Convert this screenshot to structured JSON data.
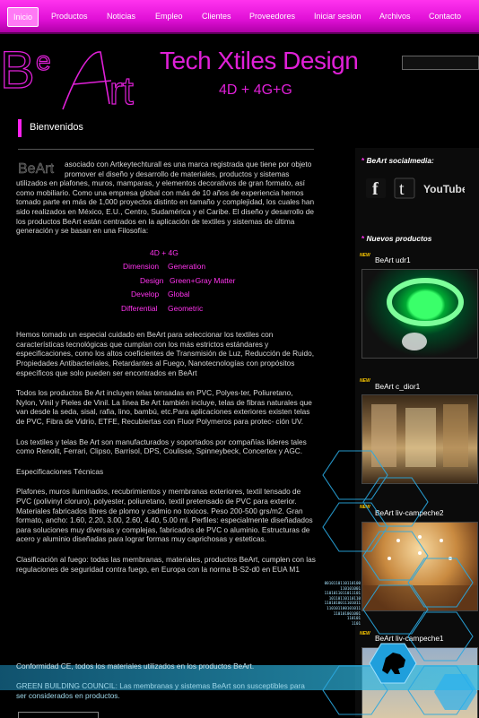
{
  "nav": {
    "items": [
      "Inicio",
      "Productos",
      "Noticias",
      "Empleo",
      "Clientes",
      "Proveedores",
      "Iniciar sesion",
      "Archivos",
      "Contacto"
    ]
  },
  "header": {
    "logo_text": "BeArt",
    "tagline": "Tech Xtiles Design",
    "subtagline": "4D + 4G+G"
  },
  "section": {
    "title": "Bienvenidos"
  },
  "intro": {
    "logo_text": "BeArt",
    "text": "asociado con Artkeytechturall es una marca registrada que tiene por objeto promover el diseño y desarrollo de materiales, productos y sistemas utilizados en plafones, muros, mamparas, y elementos decorativos de gran formato, así como mobiliario. Como una empresa global con más de 10 años de experiencia hemos tomado parte en más de 1,000 proyectos distinto en tamaño y complejidad, los cuales han sido realizados en México, E.U., Centro, Sudamérica y el Caribe. El diseño y desarrollo de los productos BeArt están centrados en la aplicación de textiles y sistemas de última generación y se basan en una Filosofía:"
  },
  "formula": {
    "line1": "4D + 4G",
    "rows": [
      [
        "Dimension",
        "Generation"
      ],
      [
        "Design",
        "Green+Gray Matter"
      ],
      [
        "Develop",
        "Global"
      ],
      [
        "Differential",
        "Geometric"
      ]
    ]
  },
  "paragraphs": [
    "Hemos tomado un especial cuidado en BeArt para seleccionar los textiles con características tecnológicas que cumplan con los más estrictos estándares y especificaciones, como los altos coeficientes de Transmisión de Luz, Reducción de Ruido, Propiedades Antibacteriales, Retardantes al Fuego, Nanotecnologías con propósitos específicos que solo pueden ser encontrados en BeArt",
    "Todos los productos Be Art incluyen telas tensadas en PVC, Polyes-ter, Poliuretano, Nylon, Vinil y Pieles de Vinil. La línea Be Art también incluye, telas de fibras naturales que van desde la seda, sisal, rafia, lino, bambú, etc.Para aplicaciones exteriores existen telas de PVC, Fibra de Vidrio, ETFE, Recubiertas con Fluor Polymeros para protec- ción UV.",
    "Los textiles y telas Be Art son manufacturados y soportados por compañías lideres tales como Renolit, Ferrari, Clipso, Barrisol, DPS, Coulisse, Spinneybeck, Concertex y AGC.",
    "Especificaciones Técnicas",
    "Plafones, muros iluminados, recubrimientos y membranas exteriores, textil tensado de PVC (polivinyl cloruro), polyester, poliuretano, textil pretensado de PVC para exterior. Materiales fabricados libres de plomo y cadmio no toxicos. Peso 200-500 grs/m2. Gran formato, ancho: 1.60, 2.20, 3.00, 2.60, 4.40, 5.00 ml. Perfiles: especialmente diseñadados para soluciones muy diversas y complejas, fabricados de PVC o aluminio. Estructuras de acero y aluminio diseñadas para lograr formas muy caprichosas y esteticas.",
    "Clasificación al fuego: todas las membranas, materiales, productos BeArt, cumplen con las regulaciones de seguridad contra fuego, en Europa con la norma B-S2-d0 en EUA M1"
  ],
  "overlay_paragraphs": [
    "Conformidad CE, todos los materiales utilizados en los productos BeArt.",
    "GREEN BUILDING COUNCIL: Las membranas y sistemas BeArt son susceptibles para ser considerados en productos."
  ],
  "sidebar": {
    "social_heading": "BeArt socialmedia:",
    "social_icons": [
      "facebook-icon",
      "twitter-icon",
      "youtube-icon"
    ],
    "youtube_label": "YouTube",
    "new_heading": "Nuevos productos",
    "new_badge": "NEW",
    "products": [
      "BeArt udr1",
      "BeArt c_dior1",
      "BeArt liv-campeche2",
      "BeArt liv-campeche1"
    ]
  },
  "binary_lines": [
    "0010110110110100",
    "110101001",
    "1101011011011101",
    "10110110110110",
    "1101010011101011",
    "110101100101011",
    "110101001001",
    "110101",
    "1101"
  ],
  "colors": {
    "accent": "#e020d8",
    "nav": "#e010d6",
    "overlay": "#1e96c8"
  }
}
